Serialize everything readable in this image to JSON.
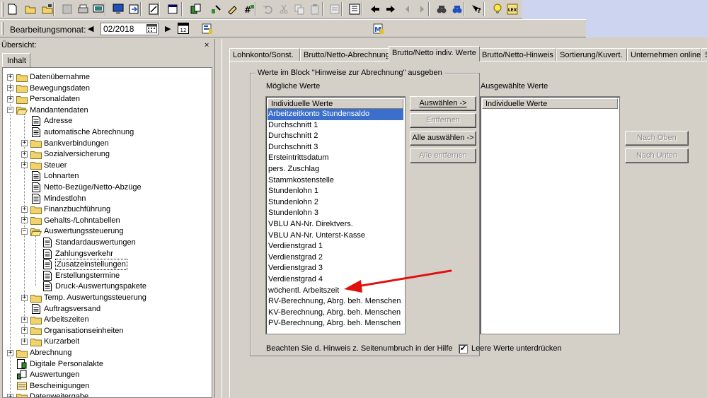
{
  "toolbar_icons": [
    "new-icon",
    "open-icon",
    "save-icon",
    "print-preview-icon",
    "print-icon",
    "screen-icon",
    "monitor-icon",
    "export-icon",
    "edit-icon",
    "window-icon",
    "copy-doc-icon",
    "tools-icon",
    "notes-icon",
    "grid-icon",
    "undo-icon",
    "cut-icon",
    "copy-icon",
    "paste-icon",
    "form-icon",
    "list-icon",
    "back-icon",
    "forward-icon",
    "prev-icon",
    "next-icon",
    "find-icon",
    "find-next-icon",
    "help-icon",
    "tip-icon",
    "lex-icon"
  ],
  "month_bar": {
    "label": "Bearbeitungsmonat:",
    "prev": "◀",
    "value": "02/2018",
    "next": "▶",
    "lex_label": "LEX"
  },
  "left_panel": {
    "overview_label": "Übersicht:",
    "close": "×",
    "tab_label": "Inhalt",
    "tree": [
      {
        "label": "Datenübernahme",
        "level": 0,
        "type": "folder",
        "exp": "+"
      },
      {
        "label": "Bewegungsdaten",
        "level": 0,
        "type": "folder",
        "exp": "+"
      },
      {
        "label": "Personaldaten",
        "level": 0,
        "type": "folder",
        "exp": "+"
      },
      {
        "label": "Mandantendaten",
        "level": 0,
        "type": "folder-open",
        "exp": "−"
      },
      {
        "label": "Adresse",
        "level": 1,
        "type": "doc"
      },
      {
        "label": "automatische Abrechnung",
        "level": 1,
        "type": "doc"
      },
      {
        "label": "Bankverbindungen",
        "level": 1,
        "type": "folder",
        "exp": "+"
      },
      {
        "label": "Sozialversicherung",
        "level": 1,
        "type": "folder",
        "exp": "+"
      },
      {
        "label": "Steuer",
        "level": 1,
        "type": "folder",
        "exp": "+"
      },
      {
        "label": "Lohnarten",
        "level": 1,
        "type": "doc"
      },
      {
        "label": "Netto-Bezüge/Netto-Abzüge",
        "level": 1,
        "type": "doc"
      },
      {
        "label": "Mindestlohn",
        "level": 1,
        "type": "doc"
      },
      {
        "label": "Finanzbuchführung",
        "level": 1,
        "type": "folder",
        "exp": "+"
      },
      {
        "label": "Gehalts-/Lohntabellen",
        "level": 1,
        "type": "folder",
        "exp": "+"
      },
      {
        "label": "Auswertungssteuerung",
        "level": 1,
        "type": "folder-open",
        "exp": "−"
      },
      {
        "label": "Standardauswertungen",
        "level": 2,
        "type": "doc"
      },
      {
        "label": "Zahlungsverkehr",
        "level": 2,
        "type": "doc"
      },
      {
        "label": "Zusatzeinstellungen",
        "level": 2,
        "type": "doc",
        "selected": true
      },
      {
        "label": "Erstellungstermine",
        "level": 2,
        "type": "doc"
      },
      {
        "label": "Druck-Auswertungspakete",
        "level": 2,
        "type": "doc"
      },
      {
        "label": "Temp. Auswertungssteuerung",
        "level": 1,
        "type": "folder",
        "exp": "+"
      },
      {
        "label": "Auftragsversand",
        "level": 1,
        "type": "doc"
      },
      {
        "label": "Arbeitszeiten",
        "level": 1,
        "type": "folder",
        "exp": "+"
      },
      {
        "label": "Organisationseinheiten",
        "level": 1,
        "type": "folder",
        "exp": "+"
      },
      {
        "label": "Kurzarbeit",
        "level": 1,
        "type": "folder",
        "exp": "+"
      },
      {
        "label": "Abrechnung",
        "level": 0,
        "type": "folder",
        "exp": "+"
      },
      {
        "label": "Digitale Personalakte",
        "level": 0,
        "type": "special"
      },
      {
        "label": "Auswertungen",
        "level": 0,
        "type": "special2"
      },
      {
        "label": "Bescheinigungen",
        "level": 0,
        "type": "special3"
      },
      {
        "label": "Datenweitergabe",
        "level": 0,
        "type": "folder",
        "exp": "+"
      }
    ]
  },
  "tabs": [
    {
      "label": "Lohnkonto/Sonst."
    },
    {
      "label": "Brutto/Netto-Abrechnung"
    },
    {
      "label": "Brutto/Netto indiv. Werte",
      "active": true
    },
    {
      "label": "Brutto/Netto-Hinweis"
    },
    {
      "label": "Sortierung/Kuvert."
    },
    {
      "label": "Unternehmen online"
    },
    {
      "label": "Sc"
    }
  ],
  "group_title": "Werte im Block \"Hinweise zur Abrechnung\" ausgeben",
  "possible": {
    "label": "Mögliche Werte",
    "header": "Individuelle Werte",
    "items": [
      "Arbeitzeitkonto Stundensaldo",
      "Durchschnitt 1",
      "Durchschnitt 2",
      "Durchschnitt 3",
      "Ersteintrittsdatum",
      "pers. Zuschlag",
      "Stammkostenstelle",
      "Stundenlohn 1",
      "Stundenlohn 2",
      "Stundenlohn 3",
      "VBLU AN-Nr. Direktvers.",
      "VBLU AN-Nr. Unterst-Kasse",
      "Verdienstgrad 1",
      "Verdienstgrad 2",
      "Verdienstgrad 3",
      "Verdienstgrad 4",
      "wöchentl. Arbeitszeit",
      "RV-Berechnung, Abrg. beh. Menschen",
      "KV-Berechnung, Abrg. beh. Menschen",
      "PV-Berechnung, Abrg. beh. Menschen"
    ]
  },
  "selected_values": {
    "label": "Ausgewählte Werte",
    "header": "Individuelle Werte"
  },
  "buttons": {
    "select": "Auswählen ->",
    "remove": "Entfernen",
    "select_all": "Alle auswählen ->",
    "remove_all": "Alle entfernen",
    "up": "Nach Oben",
    "down": "Nach Unten"
  },
  "hint": "Beachten Sie d. Hinweis z. Seitenumbruch in der Hilfe",
  "checkbox": {
    "label": "Leere Werte unterdrücken",
    "mark": "✔"
  },
  "colors": {
    "selection": "#3b6fcb",
    "arrow": "#e01010",
    "folder": "#f2d36b"
  }
}
